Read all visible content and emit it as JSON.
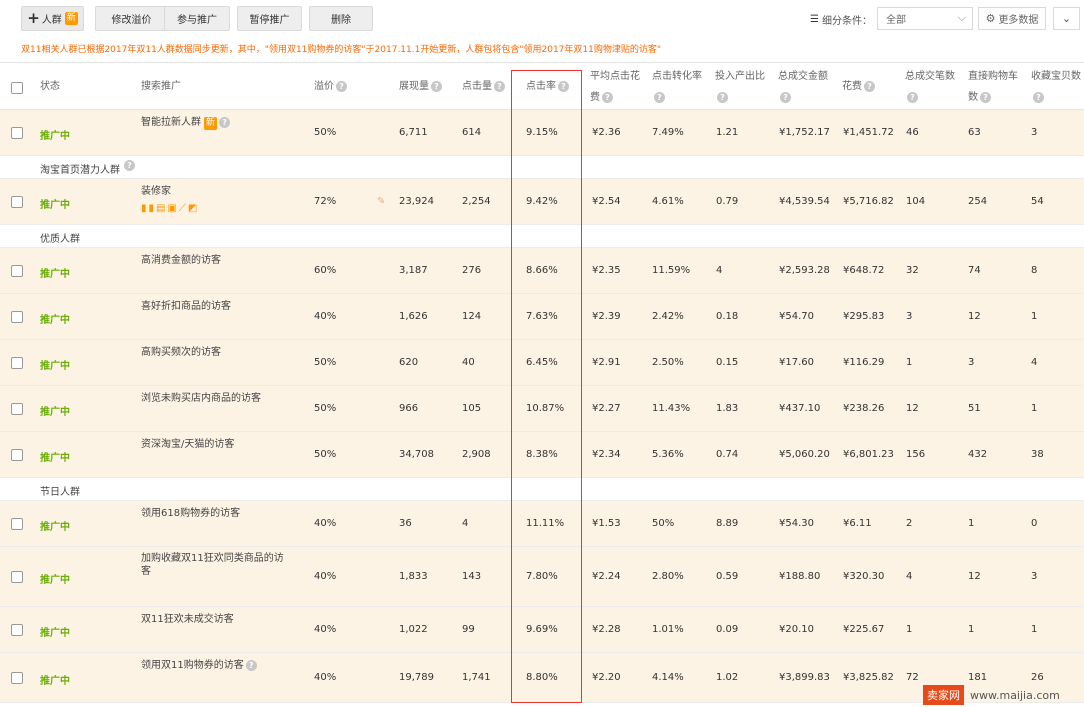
{
  "toolbar": {
    "add_label": "人群",
    "new_badge": "新",
    "buttons": [
      "修改溢价",
      "参与推广",
      "暂停推广",
      "删除"
    ],
    "filter_label": "细分条件：",
    "filter_value": "全部",
    "more_data": "更多数据"
  },
  "notice": "双11相关人群已根据2017年双11人群数据同步更新，其中，\"领用双11购物券的访客\"于2017.11.1开始更新，人群包将包含\"领用2017年双11购物津贴的访客\"",
  "columns": {
    "status": "状态",
    "search": "搜索推广",
    "premium": "溢价",
    "impressions": "展现量",
    "clicks": "点击量",
    "ctr": "点击率",
    "cpc": [
      "平均点击花",
      "费"
    ],
    "cvr": "点击转化率",
    "roi": "投入产出比",
    "gmv": "总成交金额",
    "cost": "花费",
    "orders": "总成交笔数",
    "cart": [
      "直接购物车",
      "数"
    ],
    "fav": "收藏宝贝数"
  },
  "groups": {
    "g1": "淘宝首页潜力人群",
    "g2": "优质人群",
    "g3": "节日人群"
  },
  "rows": [
    {
      "status": "推广中",
      "name": "智能拉新人群",
      "badge": "新",
      "premium": "50%",
      "imp": "6,711",
      "clk": "614",
      "ctr": "9.15%",
      "cpc": "¥2.36",
      "cvr": "7.49%",
      "roi": "1.21",
      "gmv": "¥1,752.17",
      "cost": "¥1,451.72",
      "orders": "46",
      "cart": "63",
      "fav": "3"
    },
    {
      "status": "推广中",
      "name": "装修家",
      "premium": "72%",
      "imp": "23,924",
      "clk": "2,254",
      "ctr": "9.42%",
      "cpc": "¥2.54",
      "cvr": "4.61%",
      "roi": "0.79",
      "gmv": "¥4,539.54",
      "cost": "¥5,716.82",
      "orders": "104",
      "cart": "254",
      "fav": "54"
    },
    {
      "status": "推广中",
      "name": "高消费金额的访客",
      "premium": "60%",
      "imp": "3,187",
      "clk": "276",
      "ctr": "8.66%",
      "cpc": "¥2.35",
      "cvr": "11.59%",
      "roi": "4",
      "gmv": "¥2,593.28",
      "cost": "¥648.72",
      "orders": "32",
      "cart": "74",
      "fav": "8"
    },
    {
      "status": "推广中",
      "name": "喜好折扣商品的访客",
      "premium": "40%",
      "imp": "1,626",
      "clk": "124",
      "ctr": "7.63%",
      "cpc": "¥2.39",
      "cvr": "2.42%",
      "roi": "0.18",
      "gmv": "¥54.70",
      "cost": "¥295.83",
      "orders": "3",
      "cart": "12",
      "fav": "1"
    },
    {
      "status": "推广中",
      "name": "高购买频次的访客",
      "premium": "50%",
      "imp": "620",
      "clk": "40",
      "ctr": "6.45%",
      "cpc": "¥2.91",
      "cvr": "2.50%",
      "roi": "0.15",
      "gmv": "¥17.60",
      "cost": "¥116.29",
      "orders": "1",
      "cart": "3",
      "fav": "4"
    },
    {
      "status": "推广中",
      "name": "浏览未购买店内商品的访客",
      "premium": "50%",
      "imp": "966",
      "clk": "105",
      "ctr": "10.87%",
      "cpc": "¥2.27",
      "cvr": "11.43%",
      "roi": "1.83",
      "gmv": "¥437.10",
      "cost": "¥238.26",
      "orders": "12",
      "cart": "51",
      "fav": "1"
    },
    {
      "status": "推广中",
      "name": "资深淘宝/天猫的访客",
      "premium": "50%",
      "imp": "34,708",
      "clk": "2,908",
      "ctr": "8.38%",
      "cpc": "¥2.34",
      "cvr": "5.36%",
      "roi": "0.74",
      "gmv": "¥5,060.20",
      "cost": "¥6,801.23",
      "orders": "156",
      "cart": "432",
      "fav": "38"
    },
    {
      "status": "推广中",
      "name": "领用618购物券的访客",
      "premium": "40%",
      "imp": "36",
      "clk": "4",
      "ctr": "11.11%",
      "cpc": "¥1.53",
      "cvr": "50%",
      "roi": "8.89",
      "gmv": "¥54.30",
      "cost": "¥6.11",
      "orders": "2",
      "cart": "1",
      "fav": "0"
    },
    {
      "status": "推广中",
      "name": "加购收藏双11狂欢同类商品的访客",
      "premium": "40%",
      "imp": "1,833",
      "clk": "143",
      "ctr": "7.80%",
      "cpc": "¥2.24",
      "cvr": "2.80%",
      "roi": "0.59",
      "gmv": "¥188.80",
      "cost": "¥320.30",
      "orders": "4",
      "cart": "12",
      "fav": "3"
    },
    {
      "status": "推广中",
      "name": "双11狂欢未成交访客",
      "premium": "40%",
      "imp": "1,022",
      "clk": "99",
      "ctr": "9.69%",
      "cpc": "¥2.28",
      "cvr": "1.01%",
      "roi": "0.09",
      "gmv": "¥20.10",
      "cost": "¥225.67",
      "orders": "1",
      "cart": "1",
      "fav": "1"
    },
    {
      "status": "推广中",
      "name": "领用双11购物券的访客",
      "premium": "40%",
      "imp": "19,789",
      "clk": "1,741",
      "ctr": "8.80%",
      "cpc": "¥2.20",
      "cvr": "4.14%",
      "roi": "1.02",
      "gmv": "¥3,899.83",
      "cost": "¥3,825.82",
      "orders": "72",
      "cart": "181",
      "fav": "26"
    }
  ],
  "watermark": {
    "logo": "卖家网",
    "url": "www.maijia.com"
  },
  "colors": {
    "status": "#6aaf08",
    "highlight_row": "#fdf3e5",
    "notice": "#ff6600",
    "badge": "#ff9900",
    "red_box": "#ee3333"
  }
}
